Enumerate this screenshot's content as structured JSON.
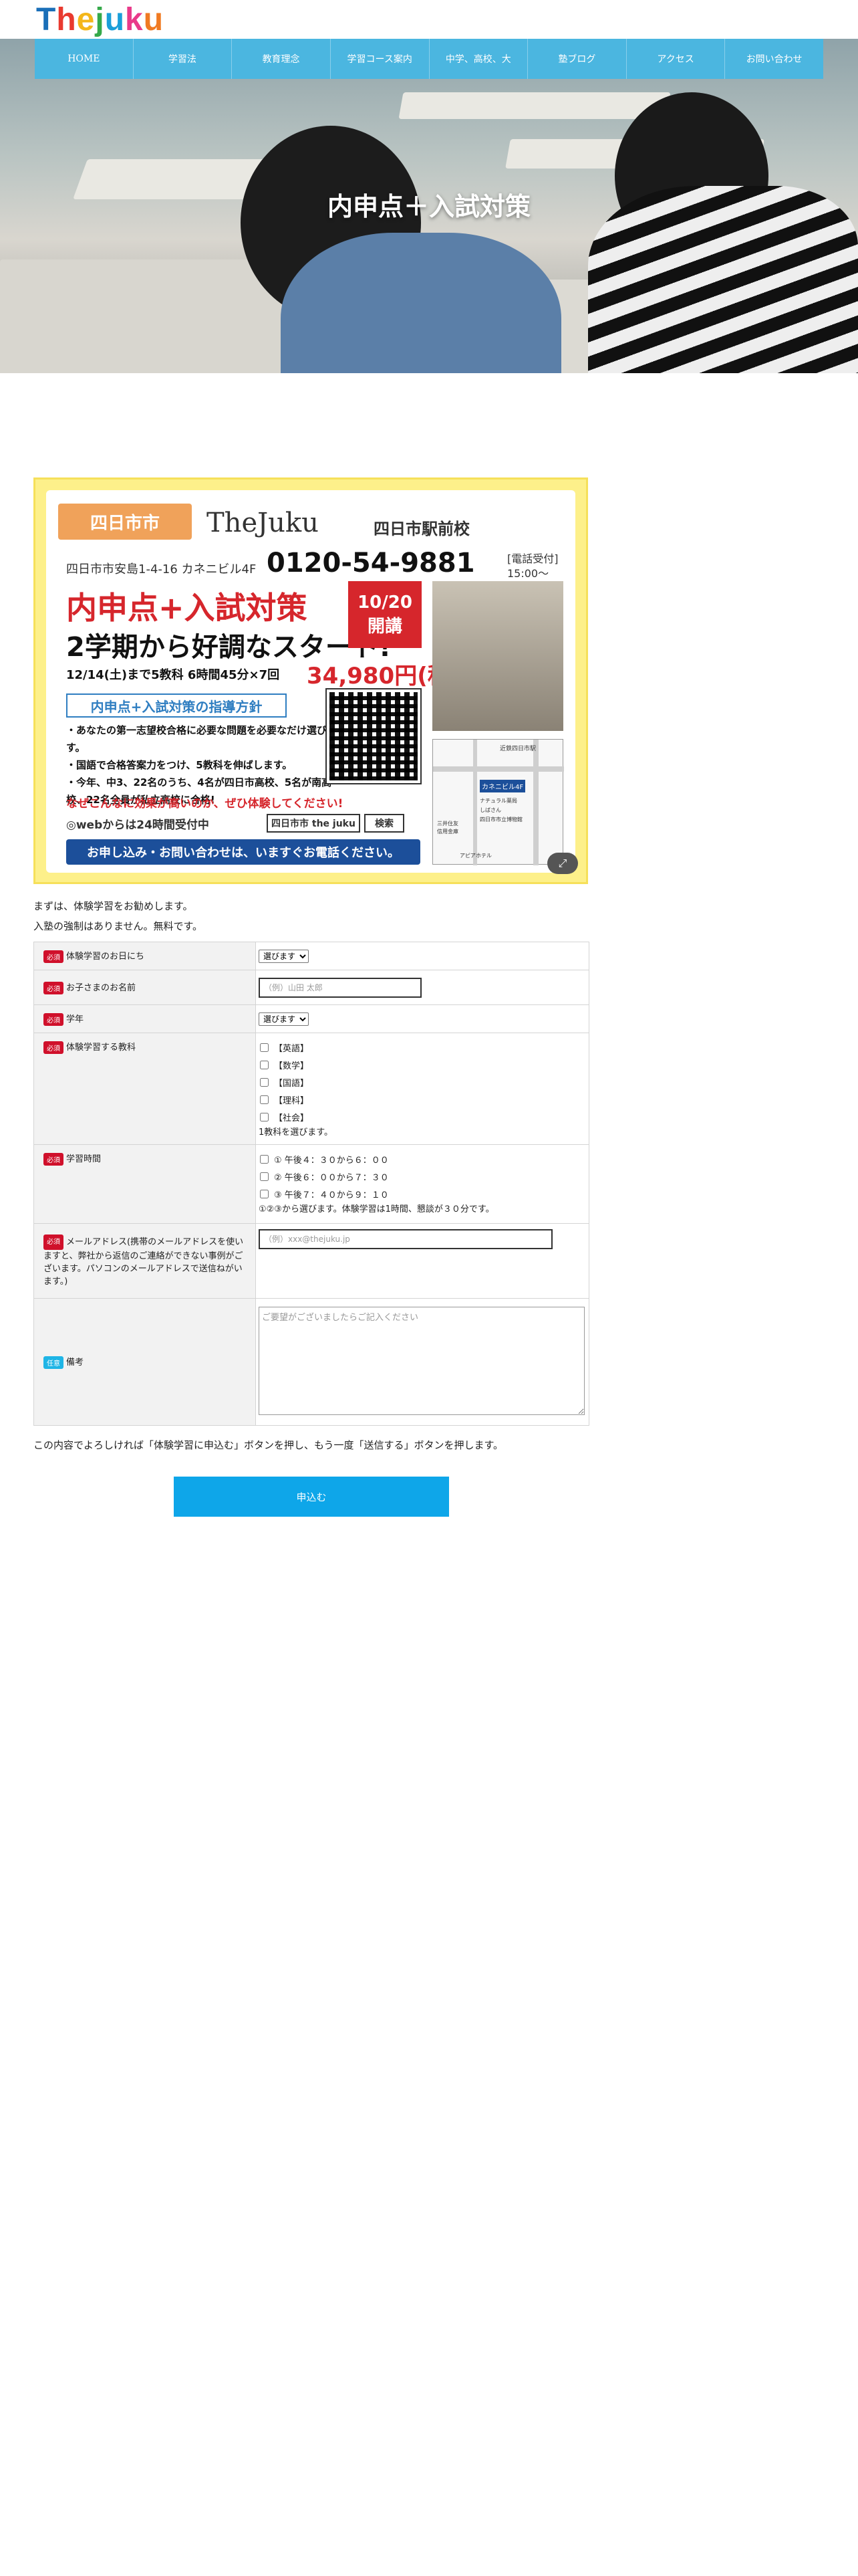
{
  "header": {
    "logo_letters": [
      "T",
      "h",
      "e",
      "j",
      "u",
      "k",
      "u"
    ],
    "logo_colors": [
      "#1a6fb8",
      "#e93a2f",
      "#f4b71a",
      "#35a94a",
      "#1a9fd9",
      "#e93a8a",
      "#f07a22"
    ]
  },
  "nav": {
    "items": [
      {
        "label": "HOME"
      },
      {
        "label": "学習法"
      },
      {
        "label": "教育理念"
      },
      {
        "label": "学習コース案内"
      },
      {
        "label": "中学、高校、大"
      },
      {
        "label": "塾ブログ"
      },
      {
        "label": "アクセス"
      },
      {
        "label": "お問い合わせ"
      }
    ],
    "color": "#4bb6e0"
  },
  "hero": {
    "title": "内申点＋入試対策"
  },
  "flyer": {
    "tag": "四日市市",
    "brand": "TheJuku",
    "branch": "四日市駅前校",
    "address": "四日市市安島1-4-16 カネニビル4F",
    "phone": "0120-54-9881",
    "hours_label": "[電話受付]",
    "hours": "15:00〜19:00",
    "headline": "内申点+入試対策",
    "subheadline": "2学期から好調なスタート!",
    "date_top": "10/20",
    "date_bottom": "開講",
    "course_line": "12/14(土)まで5教科 6時間45分×7回",
    "price": "34,980円(税込)",
    "guide_title": "内申点+入試対策の指導方針",
    "bullets": [
      "・あなたの第一志望校合格に必要な問題を必要なだけ選びます。",
      "・国語で合格答案力をつけ、5教科を伸ばします。",
      "・今年、中3、22名のうち、4名が四日市高校、5名が南高校、22名全員が私立高校に合格!"
    ],
    "cta_red": "なぜこんなに効果が高いのか、ぜひ体験してください!",
    "web_text": "◎webからは24時間受付中",
    "search_text": "四日市市 the juku",
    "search_btn": "検索",
    "bottom": "お申し込み・お問い合わせは、いますぐお電話ください。",
    "map_labels": [
      "近鉄四日市駅",
      "カネニビル4F",
      "ナチュラル薬局",
      "しばさん",
      "四日市市立博物館",
      "三井住友",
      "信用金庫",
      "アピアホテル"
    ]
  },
  "intro": {
    "line1": "まずは、体験学習をお勧めします。",
    "line2": "入塾の強制はありません。無料です。"
  },
  "form": {
    "required_badge": "必須",
    "optional_badge": "任意",
    "date_label": "体験学習のお日にち",
    "date_selected": "選びます",
    "name_label": "お子さまのお名前",
    "name_placeholder": "（例）山田 太郎",
    "grade_label": "学年",
    "grade_selected": "選びます",
    "subjects_label": "体験学習する教科",
    "subjects": [
      {
        "label": "【英語】"
      },
      {
        "label": "【数学】"
      },
      {
        "label": "【国語】"
      },
      {
        "label": "【理科】"
      },
      {
        "label": "【社会】"
      }
    ],
    "subjects_note": "1教科を選びます。",
    "time_label": "学習時間",
    "times": [
      {
        "label": "① 午後４：３０から６：００"
      },
      {
        "label": "② 午後６：００から７：３０"
      },
      {
        "label": "③ 午後７：４０から９：１０"
      }
    ],
    "time_note": "①②③から選びます。体験学習は1時間、懇談が３０分です。",
    "email_label": "メールアドレス(携帯のメールアドレスを使いますと、弊社から返信のご連絡ができない事例がございます。パソコンのメールアドレスで送信ねがいます。)",
    "email_placeholder": "（例）xxx@thejuku.jp",
    "remarks_label": "備考",
    "remarks_placeholder": "ご要望がございましたらご記入ください"
  },
  "confirm_text": "この内容でよろしければ「体験学習に申込む」ボタンを押し、もう一度「送信する」ボタンを押します。",
  "submit_label": "申込む",
  "colors": {
    "accent": "#0ea6e9",
    "required": "#d0102b",
    "optional": "#1fb5e6"
  }
}
